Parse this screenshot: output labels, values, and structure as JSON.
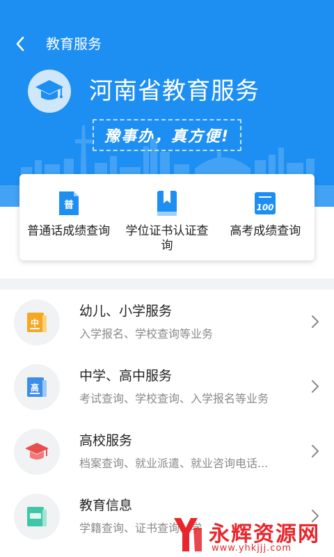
{
  "header": {
    "back_icon": "chevron-left-icon",
    "title": "教育服务"
  },
  "hero": {
    "logo_icon": "graduation-cap-icon",
    "title": "河南省教育服务",
    "slogan": "豫事办，真方便!",
    "background_color": "#1e8ff2"
  },
  "quick_actions": [
    {
      "label": "普通话成绩查询",
      "icon": "putonghua-doc-icon"
    },
    {
      "label": "学位证书认证查询",
      "icon": "bookmark-book-icon"
    },
    {
      "label": "高考成绩查询",
      "icon": "score-100-icon"
    }
  ],
  "services": [
    {
      "title": "幼儿、小学服务",
      "subtitle": "入学报名、学校查询等业务",
      "icon": "primary-school-icon"
    },
    {
      "title": "中学、高中服务",
      "subtitle": "考试查询、学校查询、入学报名等业务",
      "icon": "high-school-icon"
    },
    {
      "title": "高校服务",
      "subtitle": "档案查询、就业派遣、就业咨询电话...",
      "icon": "university-cap-icon"
    },
    {
      "title": "教育信息",
      "subtitle": "学籍查询、证书查询、学",
      "icon": "education-book-icon"
    }
  ],
  "watermark": {
    "text": "永辉资源网",
    "url": "www.yhkjjj.com"
  }
}
